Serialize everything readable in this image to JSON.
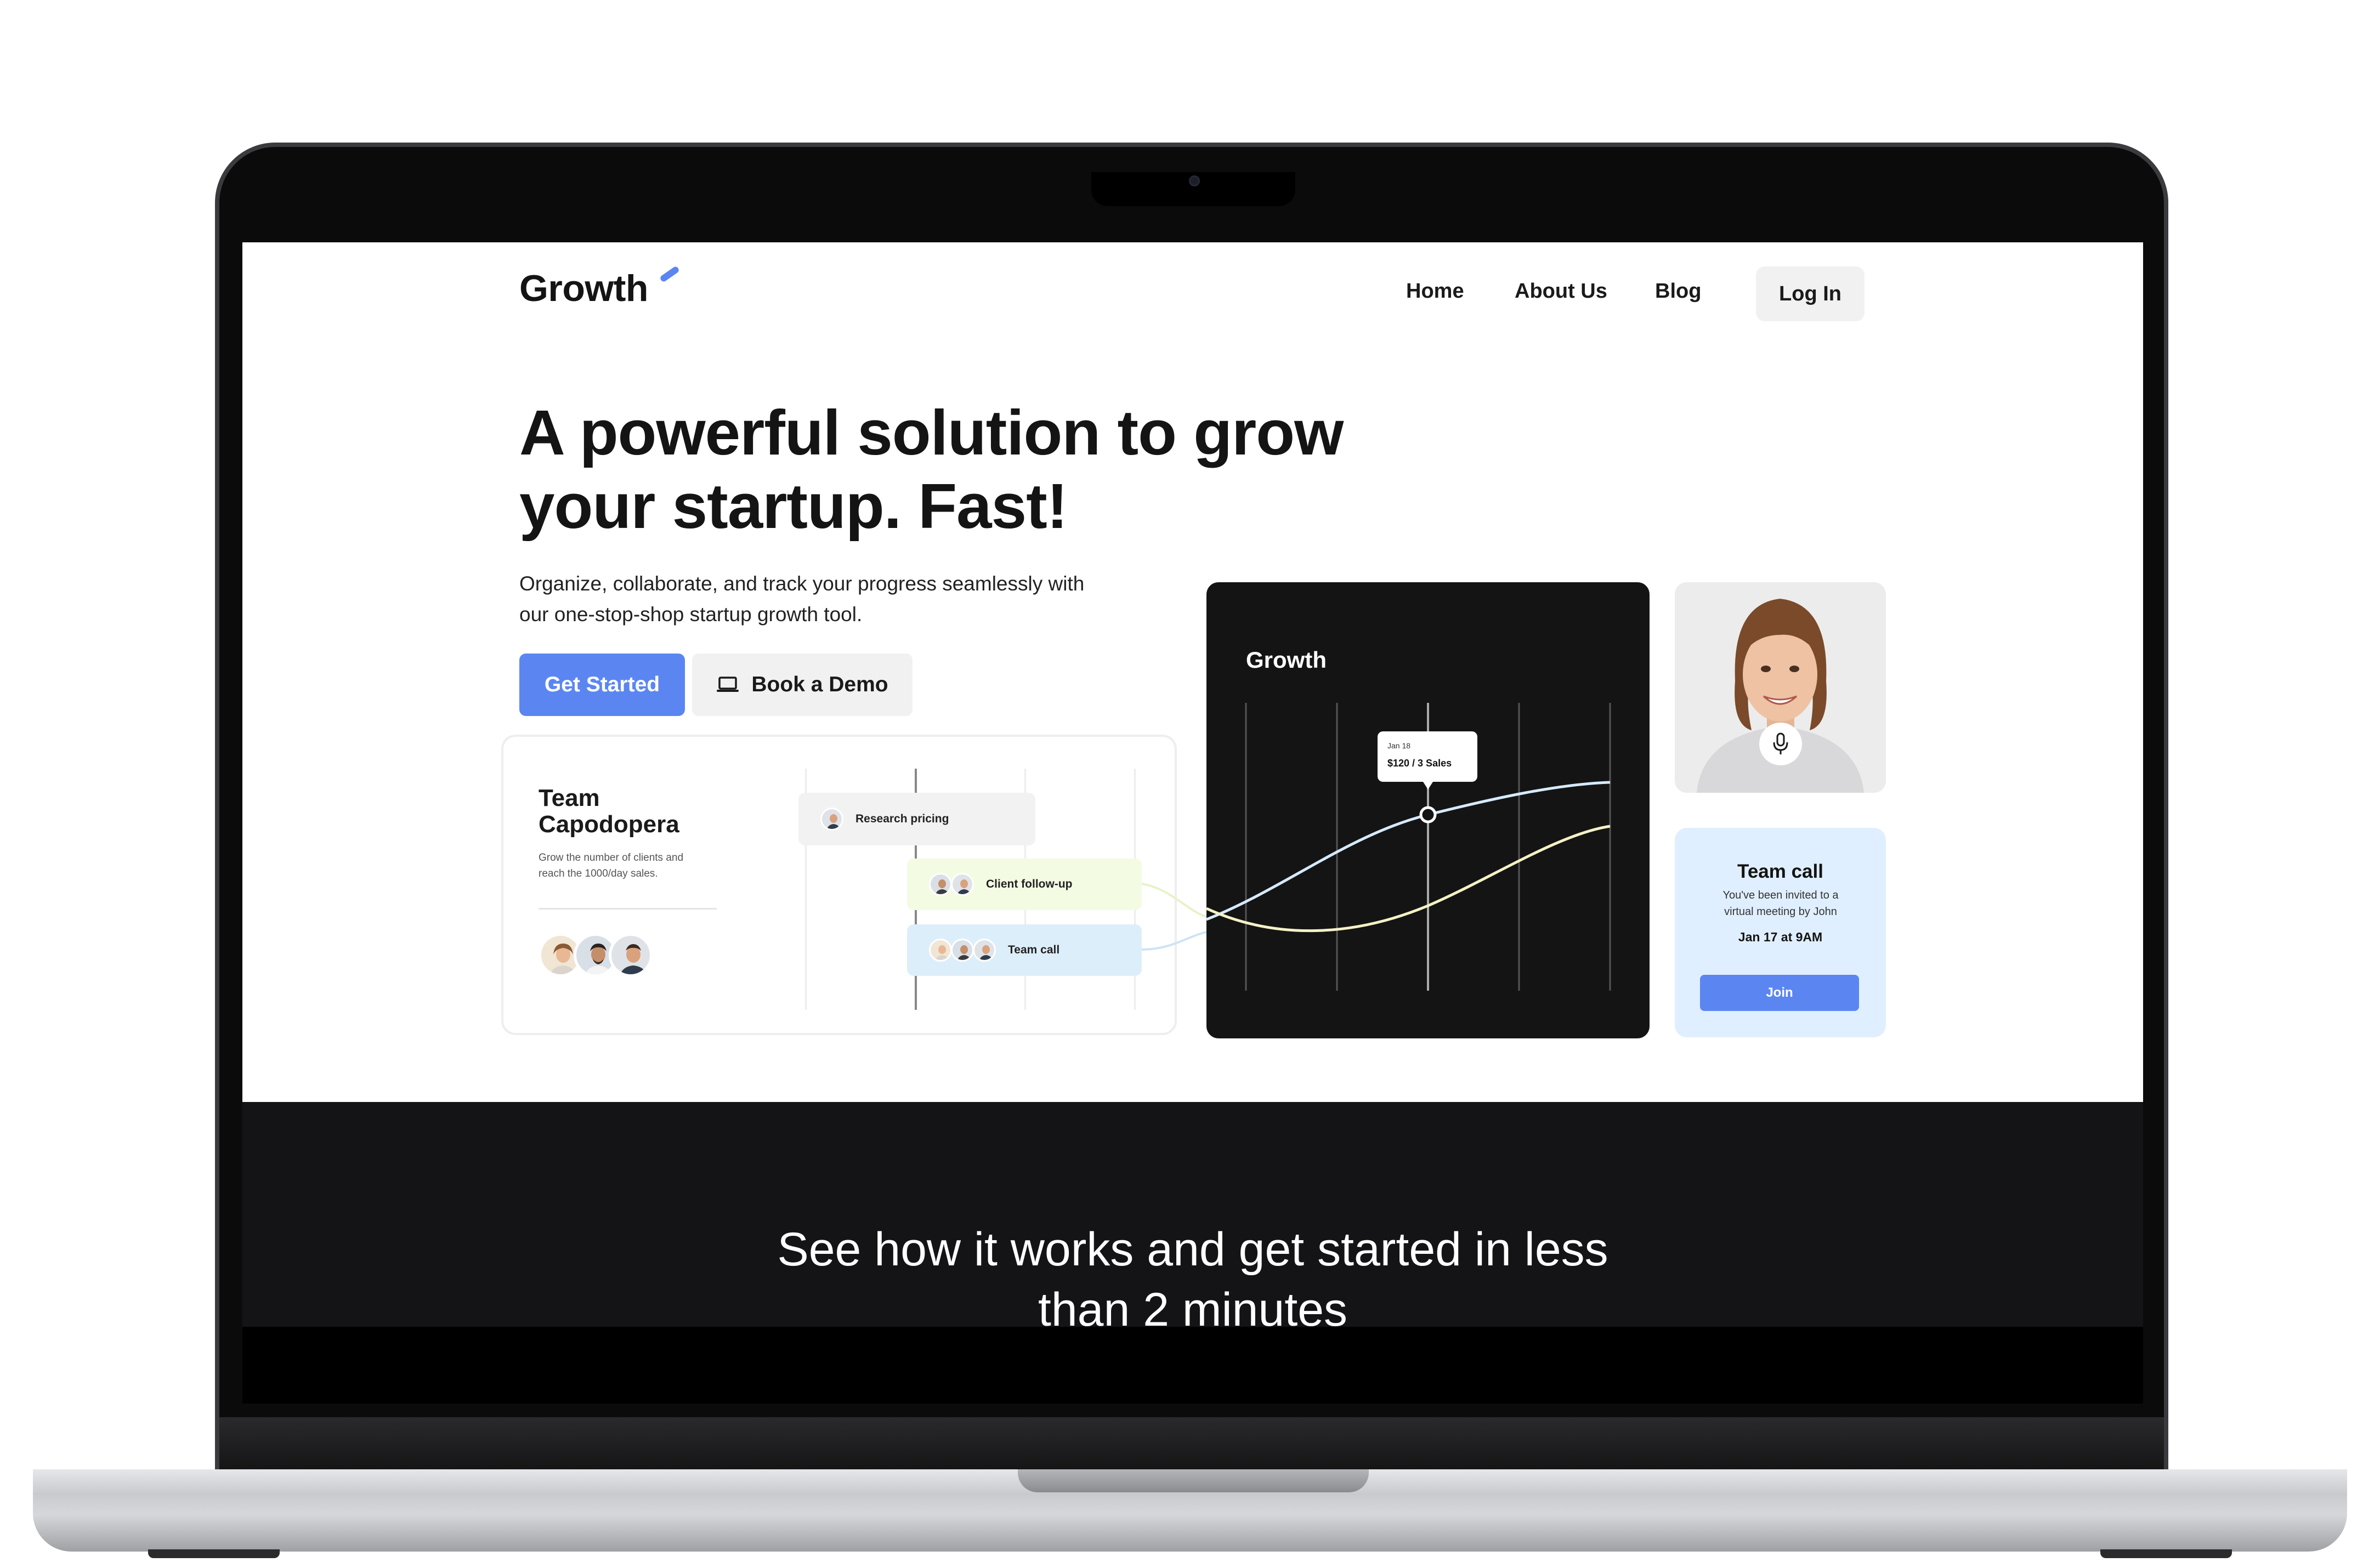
{
  "brand": {
    "name": "Growth",
    "accent": "#5b86f2"
  },
  "nav": {
    "links": [
      "Home",
      "About Us",
      "Blog"
    ],
    "login_label": "Log In"
  },
  "hero": {
    "title_line1": "A powerful solution to grow",
    "title_line2": "your startup. Fast!",
    "subtitle_line1": "Organize, collaborate, and track your progress seamlessly with",
    "subtitle_line2": "our one-stop-shop startup growth tool.",
    "primary_button": "Get Started",
    "secondary_button": "Book a Demo",
    "secondary_icon": "laptop-icon"
  },
  "team_card": {
    "title_line1": "Team",
    "title_line2": "Capodopera",
    "description_line1": "Grow the number of clients and",
    "description_line2": "reach the 1000/day sales.",
    "tasks": [
      {
        "label": "Research pricing",
        "color": "#f2f2f3"
      },
      {
        "label": "Client follow-up",
        "color": "#f3fbe3"
      },
      {
        "label": "Team call",
        "color": "#ddeefb"
      }
    ]
  },
  "growth_card": {
    "title": "Growth",
    "tooltip_date": "Jan 18",
    "tooltip_value": "$120 / 3 Sales"
  },
  "call_card": {
    "title": "Team call",
    "description_line1": "You've been invited to a",
    "description_line2": "virtual meeting by John",
    "date": "Jan 17 at 9AM",
    "join_label": "Join",
    "mic_icon": "microphone-icon"
  },
  "band": {
    "title_line1": "See how it works and get started in less",
    "title_line2": "than 2 minutes"
  }
}
